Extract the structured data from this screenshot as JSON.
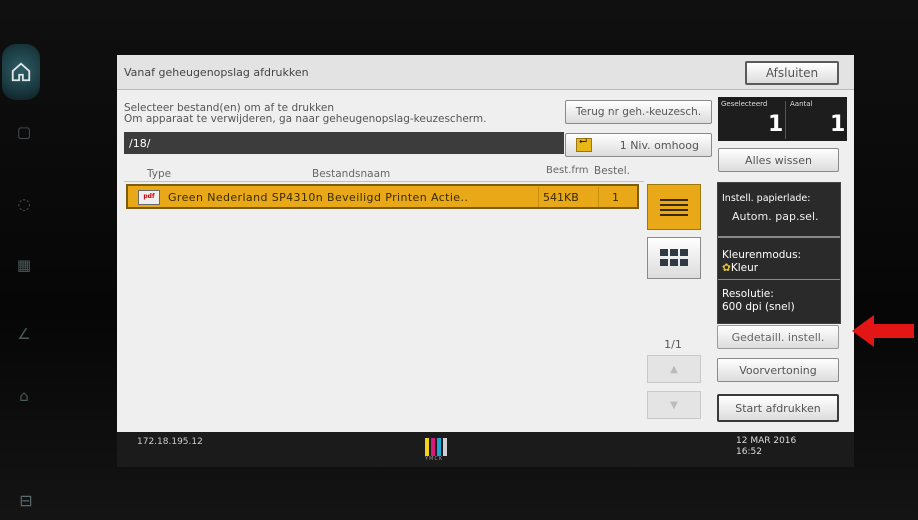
{
  "window": {
    "title": "Vanaf geheugenopslag afdrukken",
    "close_label": "Afsluiten"
  },
  "instructions": {
    "line1": "Selecteer bestand(en) om af te drukken",
    "line2": "Om apparaat te verwijderen, ga naar geheugenopslag-keuzescherm."
  },
  "buttons": {
    "back_label": "Terug nr geh.-keuzesch.",
    "up_label": "1 Niv. omhoog",
    "clear_label": "Alles wissen",
    "detail_label": "Gedetaill. instell.",
    "preview_label": "Voorvertoning",
    "start_label": "Start afdrukken"
  },
  "path": "/18/",
  "columns": {
    "type": "Type",
    "name": "Bestandsnaam",
    "size": "Best.frm",
    "count": "Bestel."
  },
  "files": [
    {
      "type": "pdf",
      "name": "Green Nederland SP4310n Beveiligd Printen Actie..",
      "size": "541KB",
      "count": "1"
    }
  ],
  "pagination": "1/1",
  "counters": {
    "selected_label": "Geselecteerd",
    "selected_value": "1",
    "count_label": "Aantal",
    "count_value": "1"
  },
  "settings": {
    "tray_label": "Instell. papierlade:",
    "tray_value": "Autom. pap.sel.",
    "color_label": "Kleurenmodus:",
    "color_value": "Kleur",
    "resolution_label": "Resolutie:",
    "resolution_value": "600 dpi (snel)"
  },
  "status": {
    "ip": "172.18.195.12",
    "date": "12 MAR  2016",
    "time": "16:52",
    "toner_label": "YMCK"
  },
  "colors": {
    "selection": "#e8a817",
    "arrow": "#e31515",
    "toner_y": "#f2d21b",
    "toner_m": "#d81b7a",
    "toner_c": "#1fa5d8",
    "toner_k": "#1c1c1c"
  },
  "icons": [
    "home-icon",
    "pdf-file-icon",
    "folder-up-icon",
    "list-view-icon",
    "grid-view-icon",
    "scroll-up-icon",
    "scroll-down-icon",
    "color-mode-icon",
    "red-arrow-icon"
  ]
}
